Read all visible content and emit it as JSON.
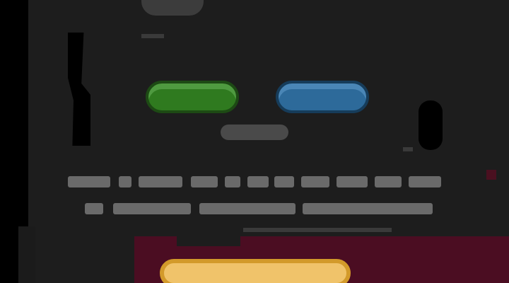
{
  "screen": {
    "colors": {
      "background": "#1d1d1d",
      "primary_button": "#2f7a1f",
      "secondary_button": "#2d6a9a",
      "footer_bar": "#4b0d22",
      "footer_button": "#f0c36a"
    },
    "buttons": {
      "green_label": "",
      "blue_label": "",
      "middle_label": "",
      "footer_label": ""
    },
    "text_lines": [
      "",
      ""
    ]
  }
}
